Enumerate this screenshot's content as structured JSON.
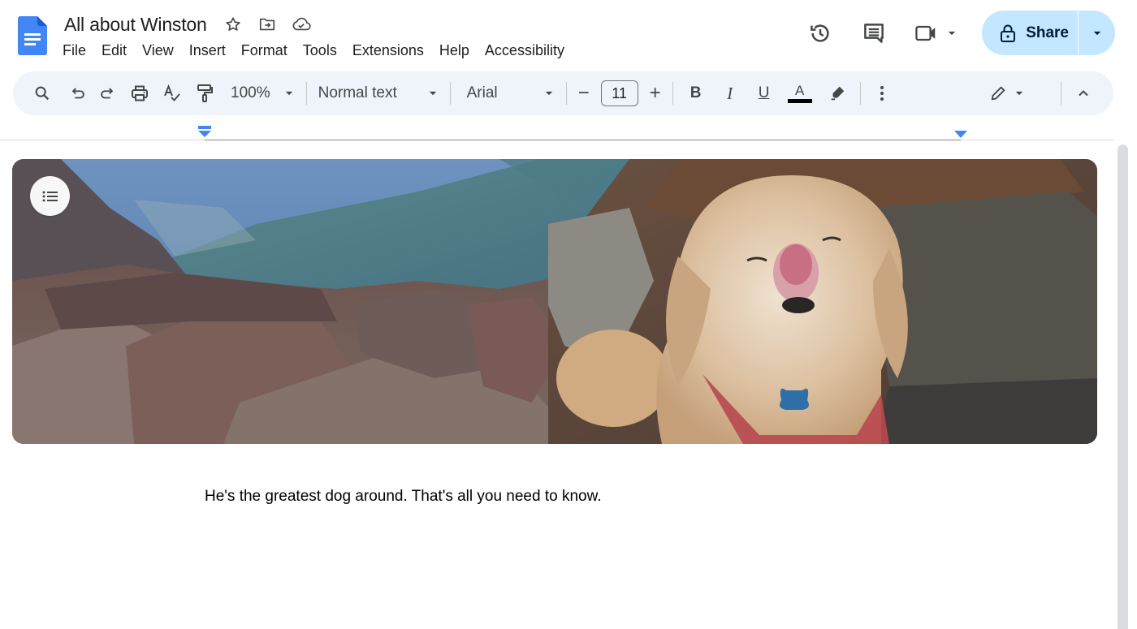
{
  "app": {
    "document_title": "All about Winston",
    "brand_color": "#4285f4"
  },
  "menu": {
    "items": [
      "File",
      "Edit",
      "View",
      "Insert",
      "Format",
      "Tools",
      "Extensions",
      "Help",
      "Accessibility"
    ]
  },
  "title_icons": {
    "star": "star-icon",
    "move": "move-to-folder-icon",
    "cloud": "cloud-saved-icon"
  },
  "header_actions": {
    "history": "version-history-icon",
    "comments": "comments-icon",
    "meet": "video-camera-icon",
    "share_label": "Share",
    "share_bg": "#c2e7ff"
  },
  "toolbar": {
    "zoom": "100%",
    "style": "Normal text",
    "font": "Arial",
    "font_size": "11",
    "minus": "−",
    "plus": "+",
    "bold": "B",
    "italic": "I",
    "underline": "U",
    "text_color_letter": "A",
    "icons": [
      "search-icon",
      "undo-icon",
      "redo-icon",
      "print-icon",
      "spellcheck-icon",
      "paint-format-icon",
      "bold-icon",
      "italic-icon",
      "underline-icon",
      "text-color-icon",
      "highlight-icon",
      "more-icon",
      "editing-mode-icon",
      "collapse-icon"
    ]
  },
  "document": {
    "image_alt": "Pekingese dog licking its nose on a rocky mountain top with a valley in the background",
    "body_text": "He's the greatest dog around. That's all you need to know."
  }
}
